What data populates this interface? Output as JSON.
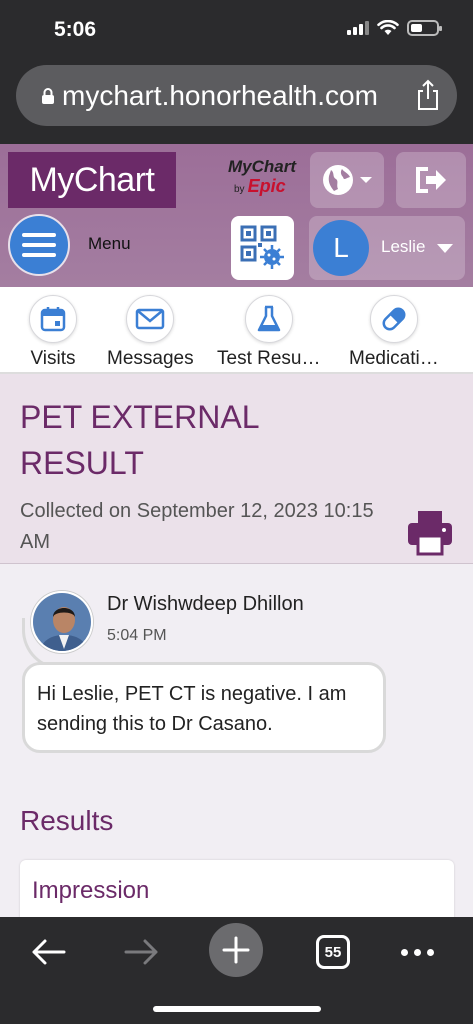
{
  "status_bar": {
    "time": "5:06"
  },
  "browser": {
    "url": "mychart.honorhealth.com",
    "tab_count": "55"
  },
  "header": {
    "logo": "MyChart",
    "epic_top": "MyChart",
    "epic_by": "by",
    "epic_brand": "Epic",
    "menu_label": "Menu",
    "user_initial": "L",
    "user_name": "Leslie"
  },
  "quick_links": [
    {
      "label": "Visits",
      "icon": "calendar-icon"
    },
    {
      "label": "Messages",
      "icon": "envelope-icon"
    },
    {
      "label": "Test Resu…",
      "icon": "flask-icon"
    },
    {
      "label": "Medicati…",
      "icon": "pill-icon"
    }
  ],
  "result": {
    "title": "PET EXTERNAL RESULT",
    "collected": "Collected on September 12, 2023 10:15 AM"
  },
  "message": {
    "author": "Dr Wishwdeep Dhillon",
    "time": "5:04 PM",
    "body": "Hi Leslie, PET CT is negative. I am sending this to Dr Casano."
  },
  "results_section": {
    "title": "Results",
    "card_title": "Impression"
  },
  "colors": {
    "brand_purple": "#6b2a68",
    "header_purple": "#a47ea1",
    "accent_blue": "#3b7fd4"
  }
}
